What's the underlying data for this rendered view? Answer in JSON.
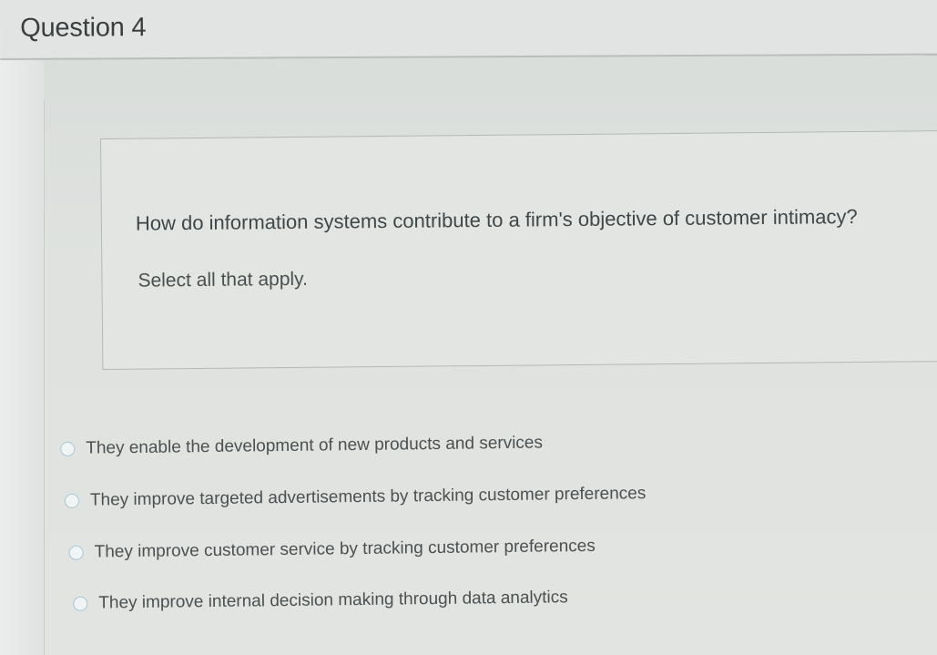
{
  "question": {
    "title": "Question 4",
    "prompt": "How do information systems contribute to a firm's objective of customer intimacy?",
    "instruction": "Select all that apply."
  },
  "options": [
    {
      "label": "They enable the development of new products and services",
      "selected": false
    },
    {
      "label": "They improve targeted advertisements by tracking customer preferences",
      "selected": false
    },
    {
      "label": "They improve customer service by tracking customer preferences",
      "selected": false
    },
    {
      "label": "They improve internal decision making through data analytics",
      "selected": false
    }
  ]
}
